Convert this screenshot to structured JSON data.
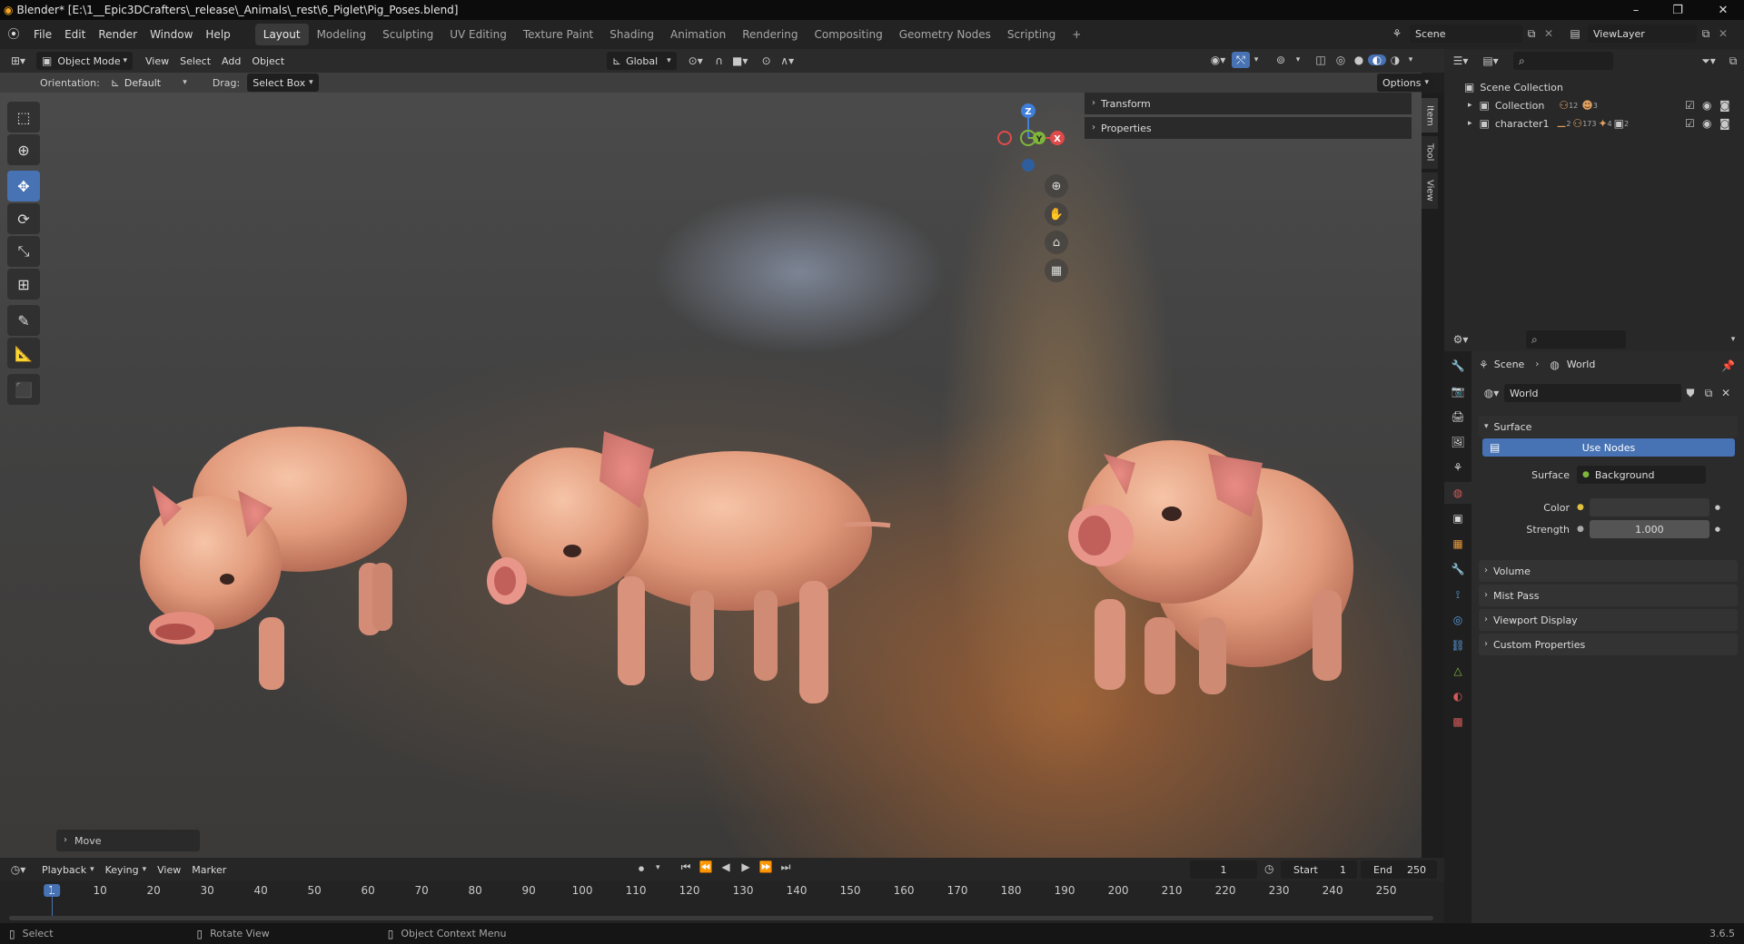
{
  "window": {
    "title": "Blender* [E:\\1__Epic3DCrafters\\_release\\_Animals\\_rest\\6_Piglet\\Pig_Poses.blend]",
    "minimize": "–",
    "maximize": "❐",
    "close": "✕"
  },
  "menubar": {
    "items": [
      "File",
      "Edit",
      "Render",
      "Window",
      "Help"
    ],
    "workspaces": [
      "Layout",
      "Modeling",
      "Sculpting",
      "UV Editing",
      "Texture Paint",
      "Shading",
      "Animation",
      "Rendering",
      "Compositing",
      "Geometry Nodes",
      "Scripting"
    ],
    "active_workspace": "Layout",
    "add_workspace": "+",
    "scene": "Scene",
    "view_layer": "ViewLayer"
  },
  "viewport_header": {
    "mode": "Object Mode",
    "menus": [
      "View",
      "Select",
      "Add",
      "Object"
    ],
    "transform_orientation": "Global",
    "options": "Options"
  },
  "tool_settings": {
    "orientation_label": "Orientation:",
    "orientation_value": "Default",
    "drag_label": "Drag:",
    "drag_value": "Select Box"
  },
  "gizmo": {
    "z": "Z",
    "y": "Y",
    "x": "X"
  },
  "n_panel": {
    "sections": [
      "Transform",
      "Properties"
    ],
    "tabs": [
      "Item",
      "Tool",
      "View"
    ]
  },
  "last_operator": "Move",
  "outliner": {
    "root": "Scene Collection",
    "items": [
      {
        "name": "Collection",
        "badge1": "12",
        "badge2": "3"
      },
      {
        "name": "character1",
        "badge1": "2",
        "badge2": "173",
        "badge3": "4",
        "badge4": "2"
      }
    ]
  },
  "properties": {
    "breadcrumb": [
      "Scene",
      "World"
    ],
    "world_name": "World",
    "surface_header": "Surface",
    "use_nodes": "Use Nodes",
    "surface_label": "Surface",
    "surface_value": "Background",
    "color_label": "Color",
    "strength_label": "Strength",
    "strength_value": "1.000",
    "collapsed_sections": [
      "Volume",
      "Mist Pass",
      "Viewport Display",
      "Custom Properties"
    ]
  },
  "timeline": {
    "menus": [
      "Playback",
      "Keying",
      "View",
      "Marker"
    ],
    "current_frame": "1",
    "start_label": "Start",
    "start_value": "1",
    "end_label": "End",
    "end_value": "250",
    "ticks": [
      "1",
      "10",
      "20",
      "30",
      "40",
      "50",
      "60",
      "70",
      "80",
      "90",
      "100",
      "110",
      "120",
      "130",
      "140",
      "150",
      "160",
      "170",
      "180",
      "190",
      "200",
      "210",
      "220",
      "230",
      "240",
      "250"
    ]
  },
  "statusbar": {
    "select": "Select",
    "rotate": "Rotate View",
    "context": "Object Context Menu",
    "version": "3.6.5"
  },
  "colors": {
    "accent": "#4772b3",
    "axis_x": "#e04a4a",
    "axis_y": "#7fb53c",
    "axis_z": "#3f7fdb",
    "background": "#424242"
  }
}
